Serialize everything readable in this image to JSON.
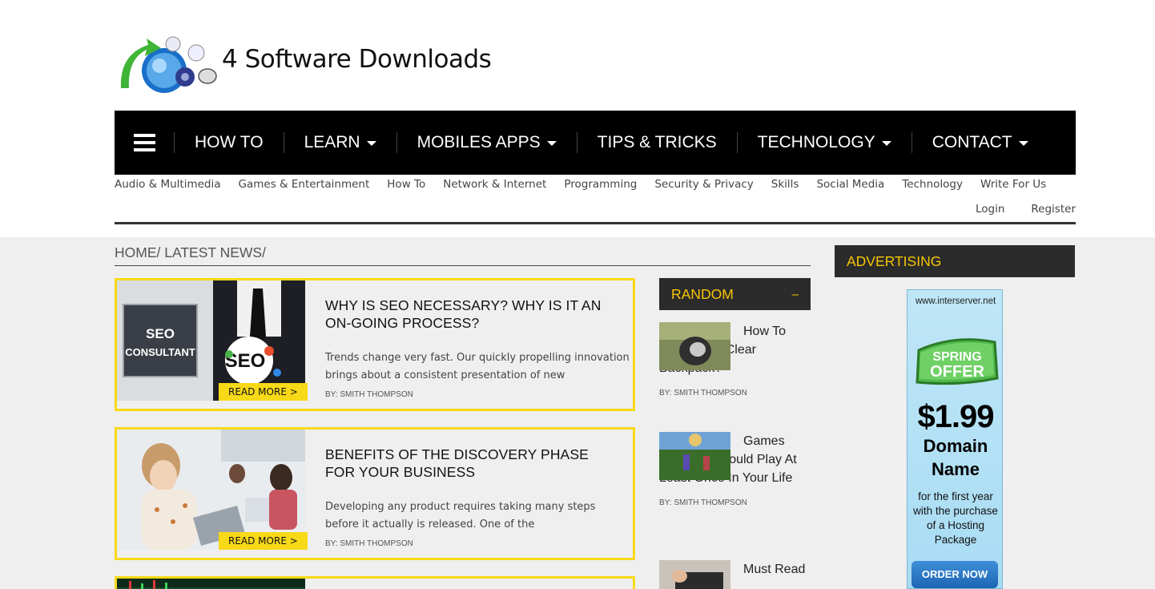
{
  "site": {
    "title": "4 Software Downloads"
  },
  "nav": {
    "items": [
      {
        "label": "HOW TO",
        "dropdown": false
      },
      {
        "label": "LEARN",
        "dropdown": true
      },
      {
        "label": "MOBILES APPS",
        "dropdown": true
      },
      {
        "label": "TIPS & TRICKS",
        "dropdown": false
      },
      {
        "label": "TECHNOLOGY",
        "dropdown": true
      },
      {
        "label": "CONTACT",
        "dropdown": true
      }
    ]
  },
  "categories": [
    "Audio & Multimedia",
    "Games & Entertainment",
    "How To",
    "Network & Internet",
    "Programming",
    "Security & Privacy",
    "Skills",
    "Social Media",
    "Technology",
    "Write For Us"
  ],
  "auth": {
    "login": "Login",
    "register": "Register"
  },
  "breadcrumb": "HOME/ LATEST NEWS/",
  "articles": [
    {
      "title": "WHY IS SEO NECESSARY? WHY IS IT AN ON-GOING PROCESS?",
      "excerpt": "Trends change very fast. Our quickly propelling innovation brings about a consistent presentation of new",
      "byline": "BY: SMITH THOMPSON",
      "read_more": "READ MORE >",
      "thumb_text_1": "SEO",
      "thumb_text_2": "CONSULTANT",
      "thumb_text_3": "SEO"
    },
    {
      "title": "BENEFITS OF THE DISCOVERY PHASE FOR YOUR BUSINESS",
      "excerpt": "Developing any product requires taking many steps before it actually is released. One of the",
      "byline": "BY: SMITH THOMPSON",
      "read_more": "READ MORE >"
    }
  ],
  "random": {
    "heading": "RANDOM",
    "toggle": "–",
    "items": [
      {
        "title": "How To Decorate A Clear Backpack?",
        "byline": "BY: SMITH THOMPSON"
      },
      {
        "title": "Games That You Should Play At Least Once In Your Life",
        "byline": "BY: SMITH THOMPSON"
      },
      {
        "title": "Must Read These Tips",
        "byline": ""
      }
    ]
  },
  "advertising": {
    "heading": "ADVERTISING",
    "url": "www.interserver.net",
    "badge_line1": "SPRING",
    "badge_line2": "OFFER",
    "price": "$1.99",
    "product": "Domain Name",
    "desc": "for the first year with the purchase of a Hosting Package",
    "cta": "ORDER NOW"
  },
  "colors": {
    "accent": "#f7d917",
    "nav_bg": "#000000",
    "header_dark": "#2b2b2b",
    "accent_text": "#f7c600"
  }
}
